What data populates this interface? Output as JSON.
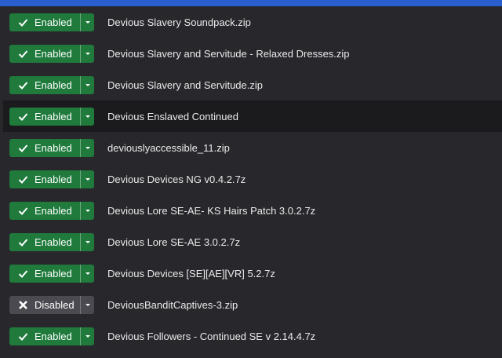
{
  "accent": "#2a5fd0",
  "colors": {
    "enabled": "#1f7a3c",
    "disabled": "#4a4a50",
    "row_hover": "#1b1b1d"
  },
  "mods": [
    {
      "status": "Enabled",
      "name": "Devious Slavery Soundpack.zip"
    },
    {
      "status": "Enabled",
      "name": "Devious Slavery and Servitude - Relaxed Dresses.zip"
    },
    {
      "status": "Enabled",
      "name": "Devious Slavery and Servitude.zip"
    },
    {
      "status": "Enabled",
      "name": "Devious Enslaved Continued"
    },
    {
      "status": "Enabled",
      "name": "deviouslyaccessible_11.zip"
    },
    {
      "status": "Enabled",
      "name": "Devious Devices NG v0.4.2.7z"
    },
    {
      "status": "Enabled",
      "name": "Devious Lore SE-AE- KS Hairs Patch 3.0.2.7z"
    },
    {
      "status": "Enabled",
      "name": "Devious Lore SE-AE 3.0.2.7z"
    },
    {
      "status": "Enabled",
      "name": "Devious Devices [SE][AE][VR] 5.2.7z"
    },
    {
      "status": "Disabled",
      "name": "DeviousBanditCaptives-3.zip"
    },
    {
      "status": "Enabled",
      "name": "Devious Followers - Continued SE v 2.14.4.7z"
    }
  ]
}
